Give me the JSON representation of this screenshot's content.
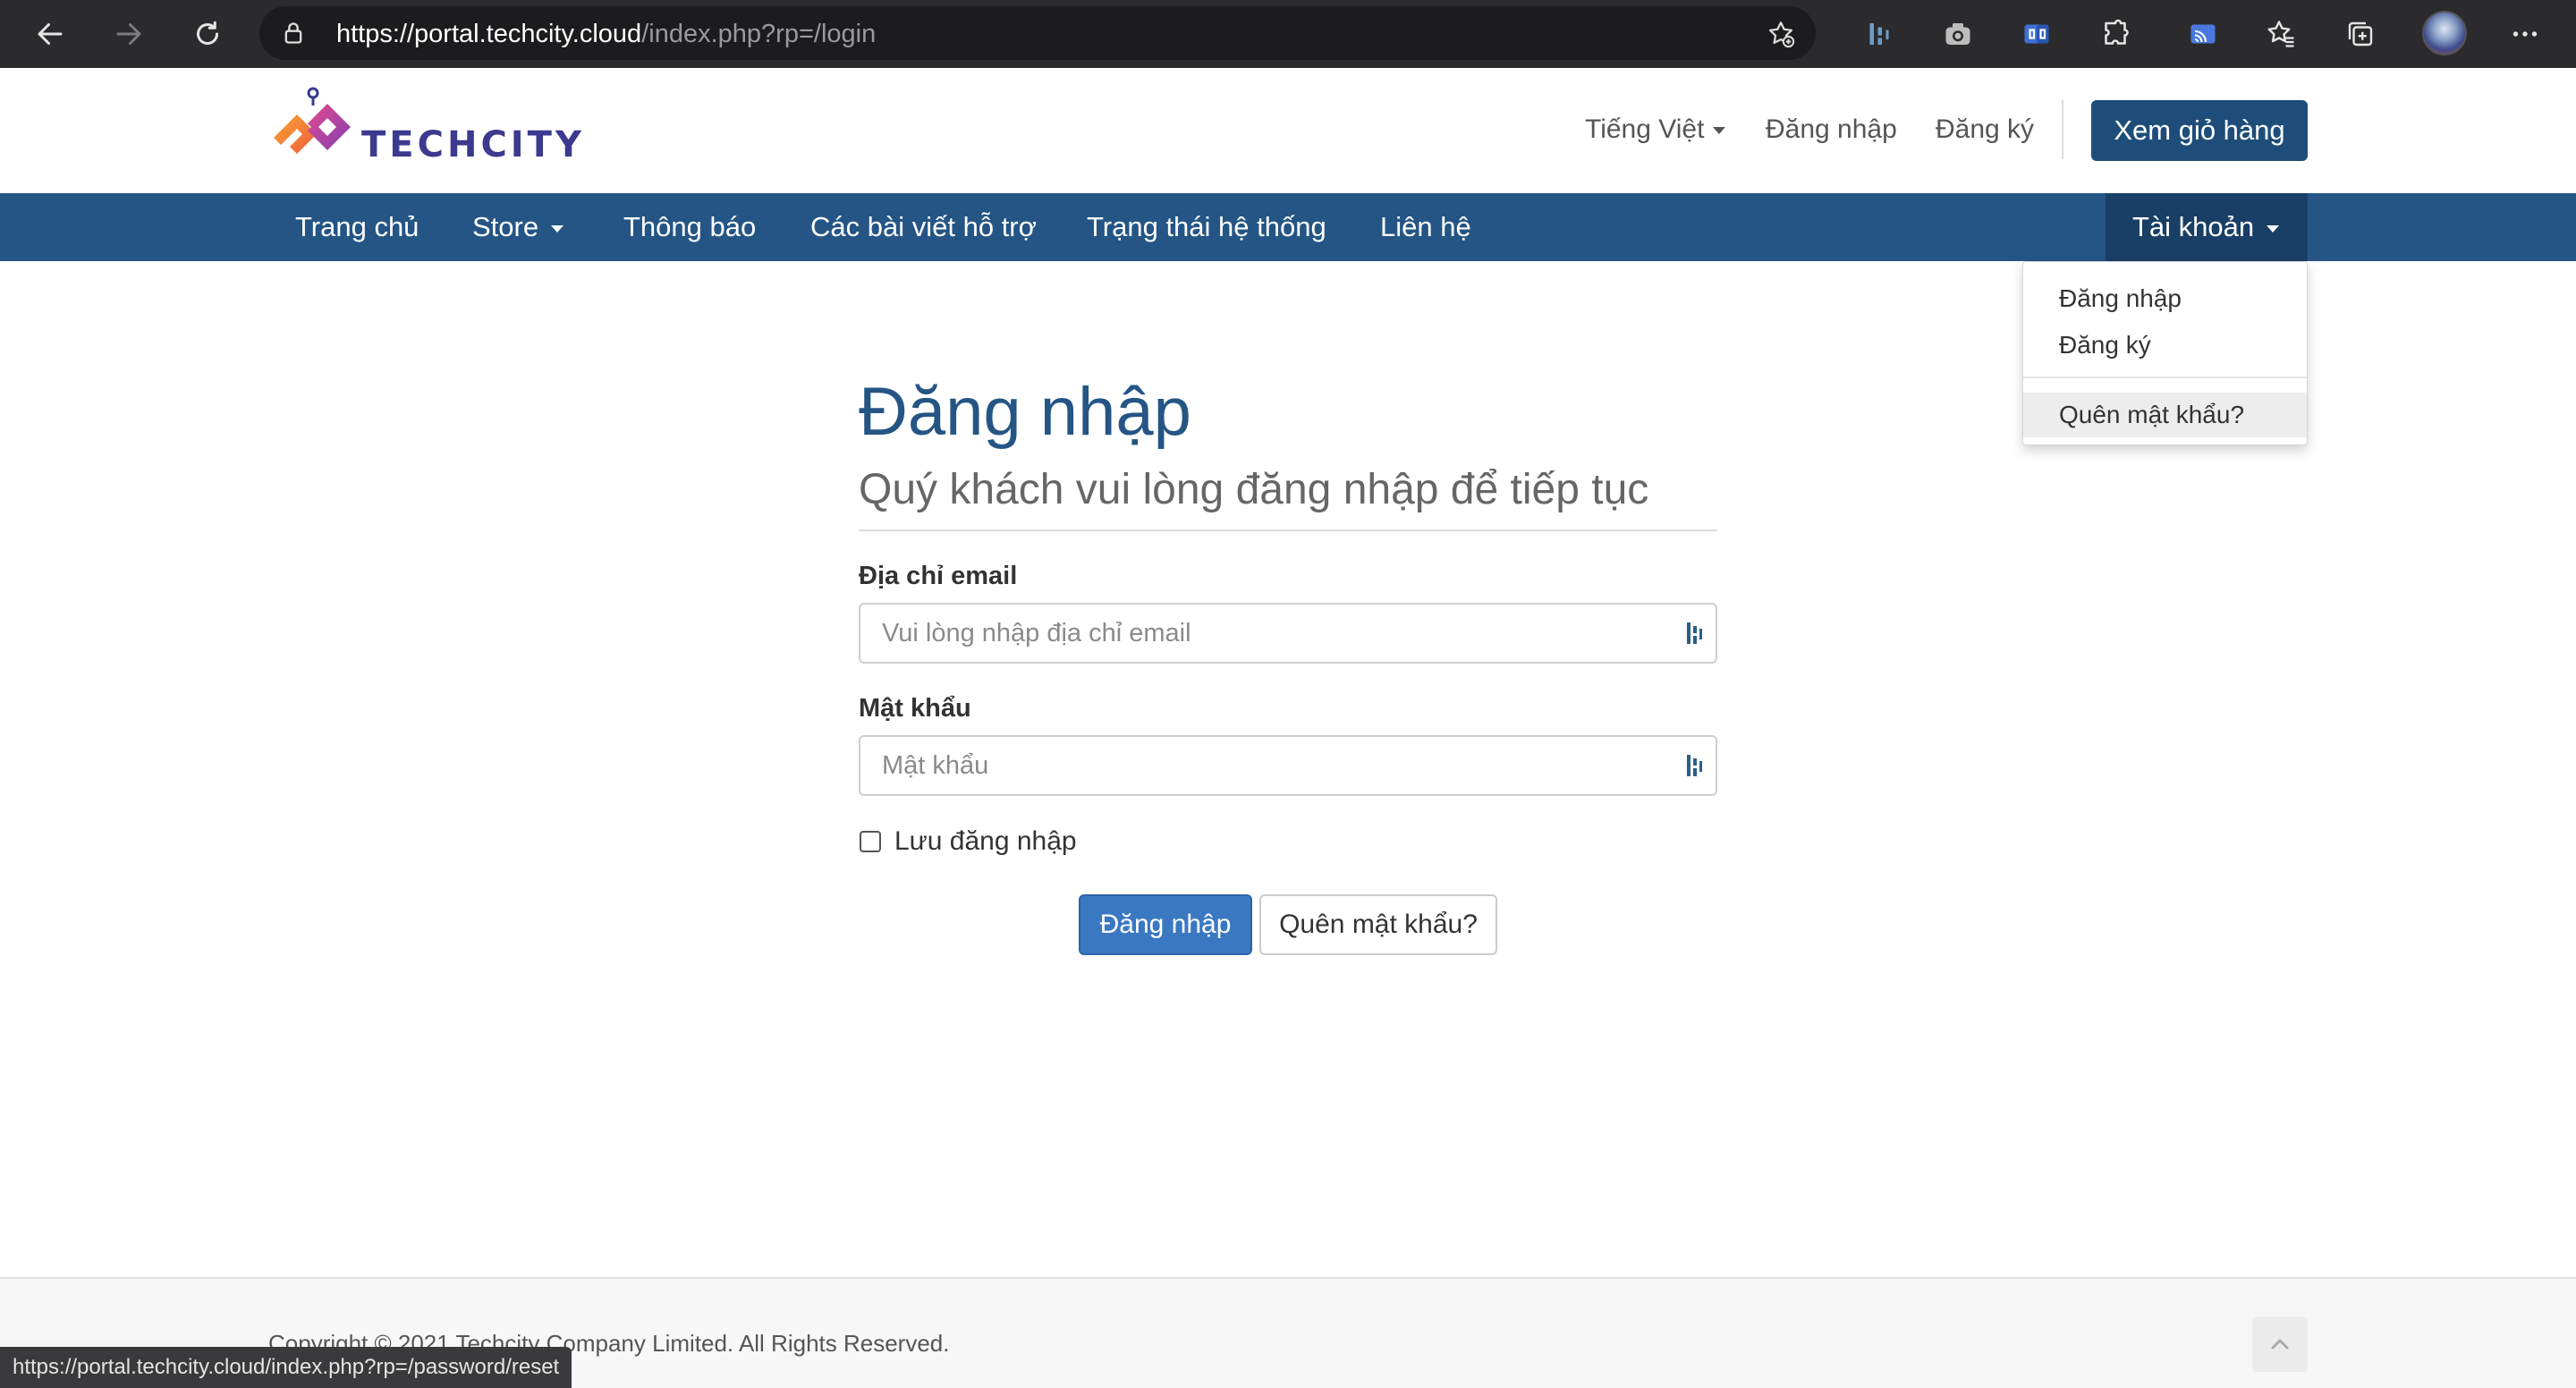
{
  "browser": {
    "url_host": "https://portal.techcity.cloud",
    "url_path": "/index.php?rp=/login",
    "status_url": "https://portal.techcity.cloud/index.php?rp=/password/reset"
  },
  "header": {
    "logo_text": "TECHCITY",
    "language": "Tiếng Việt",
    "login_link": "Đăng nhập",
    "register_link": "Đăng ký",
    "cart_button": "Xem giỏ hàng"
  },
  "nav": {
    "items": [
      "Trang chủ",
      "Store",
      "Thông báo",
      "Các bài viết hỗ trợ",
      "Trạng thái hệ thống",
      "Liên hệ"
    ],
    "account": "Tài khoản"
  },
  "account_menu": {
    "login": "Đăng nhập",
    "register": "Đăng ký",
    "forgot": "Quên mật khẩu?"
  },
  "login": {
    "title": "Đăng nhập",
    "subtitle": "Quý khách vui lòng đăng nhập để tiếp tục",
    "email_label": "Địa chỉ email",
    "email_placeholder": "Vui lòng nhập địa chỉ email",
    "password_label": "Mật khẩu",
    "password_placeholder": "Mật khẩu",
    "remember_label": "Lưu đăng nhập",
    "submit_button": "Đăng nhập",
    "forgot_button": "Quên mật khẩu?"
  },
  "footer": {
    "copyright": "Copyright © 2021 Techcity Company Limited. All Rights Reserved."
  },
  "colors": {
    "brand_blue": "#245585",
    "nav_active": "#1a3f66",
    "primary_button": "#3a78c2"
  }
}
